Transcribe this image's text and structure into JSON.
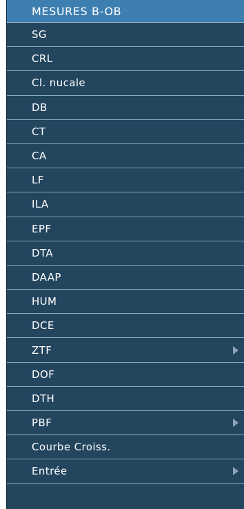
{
  "menu": {
    "title": "MESURES B-OB",
    "items": [
      {
        "label": "SG",
        "submenu": false
      },
      {
        "label": "CRL",
        "submenu": false
      },
      {
        "label": "Cl. nucale",
        "submenu": false
      },
      {
        "label": "DB",
        "submenu": false
      },
      {
        "label": "CT",
        "submenu": false
      },
      {
        "label": "CA",
        "submenu": false
      },
      {
        "label": "LF",
        "submenu": false
      },
      {
        "label": "ILA",
        "submenu": false
      },
      {
        "label": "EPF",
        "submenu": false
      },
      {
        "label": "DTA",
        "submenu": false
      },
      {
        "label": "DAAP",
        "submenu": false
      },
      {
        "label": "HUM",
        "submenu": false
      },
      {
        "label": "DCE",
        "submenu": false
      },
      {
        "label": "ZTF",
        "submenu": true
      },
      {
        "label": "DOF",
        "submenu": false
      },
      {
        "label": "DTH",
        "submenu": false
      },
      {
        "label": "PBF",
        "submenu": true
      },
      {
        "label": "Courbe Croiss.",
        "submenu": false
      },
      {
        "label": "Entrée",
        "submenu": true
      }
    ]
  },
  "colors": {
    "menu_background": "#23455e",
    "title_background": "#3d7fb0",
    "separator": "#8fa9bc",
    "text": "#ffffff",
    "submenu_arrow": "#8aa3b6"
  }
}
